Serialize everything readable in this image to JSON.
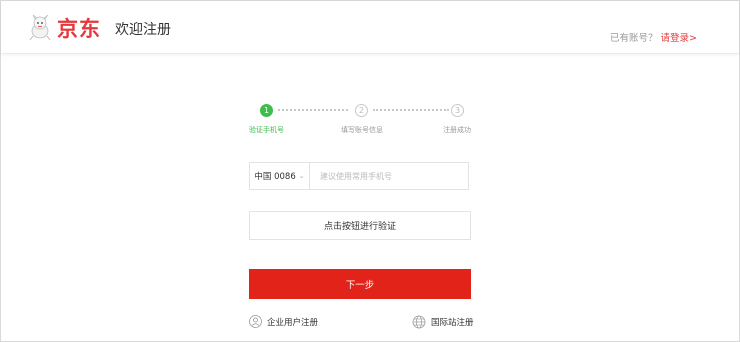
{
  "header": {
    "brand": "京东",
    "welcome": "欢迎注册",
    "login_hint": "已有账号？",
    "login_link": "请登录>"
  },
  "steps": [
    {
      "number": "1",
      "label": "验证手机号",
      "state": "active"
    },
    {
      "number": "2",
      "label": "填写账号信息",
      "state": "todo"
    },
    {
      "number": "3",
      "label": "注册成功",
      "state": "todo"
    }
  ],
  "form": {
    "country_code": "中国 0086",
    "phone_placeholder": "建议使用常用手机号",
    "verify_label": "点击按钮进行验证",
    "next_label": "下一步"
  },
  "links": {
    "enterprise": "企业用户注册",
    "international": "国际站注册"
  },
  "colors": {
    "brand_red": "#e4393c",
    "button_red": "#e2231a",
    "step_green": "#3ebd4b"
  }
}
